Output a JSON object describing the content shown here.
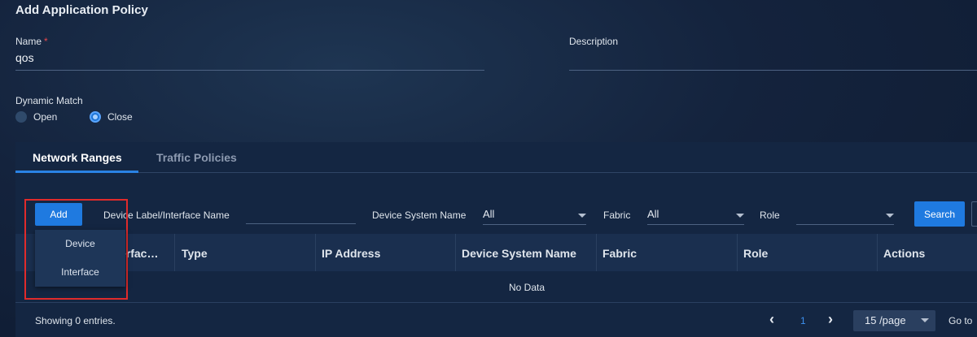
{
  "page": {
    "title": "Add Application Policy"
  },
  "form": {
    "name_label": "Name",
    "name_required": "*",
    "name_value": "qos",
    "description_label": "Description",
    "description_value": "",
    "dynamic_match_label": "Dynamic Match",
    "radio_options": [
      {
        "label": "Open",
        "checked": false
      },
      {
        "label": "Close",
        "checked": true
      }
    ]
  },
  "tabs": [
    {
      "label": "Network Ranges",
      "active": true
    },
    {
      "label": "Traffic Policies",
      "active": false
    }
  ],
  "toolbar": {
    "add_label": "Add",
    "add_menu": [
      "Device",
      "Interface"
    ],
    "device_label_filter": "Device Label/Interface Name",
    "device_label_value": "",
    "system_name_filter": "Device System Name",
    "system_name_value": "All",
    "fabric_filter": "Fabric",
    "fabric_value": "All",
    "role_filter": "Role",
    "role_value": "",
    "search_label": "Search"
  },
  "table": {
    "columns": [
      "Device Label/Interfac…",
      "Type",
      "IP Address",
      "Device System Name",
      "Fabric",
      "Role",
      "Actions"
    ],
    "visible_first_column_fragment": "erfac…",
    "empty_text": "No Data"
  },
  "pagination": {
    "showing_text": "Showing 0 entries.",
    "current_page": "1",
    "page_size": "15 /page",
    "goto_label": "Go to",
    "prev_icon": "chevron-left-icon",
    "next_icon": "chevron-right-icon"
  },
  "colors": {
    "accent": "#1f7ae0",
    "highlight_box": "#e02b2b",
    "required": "#e5484d"
  }
}
